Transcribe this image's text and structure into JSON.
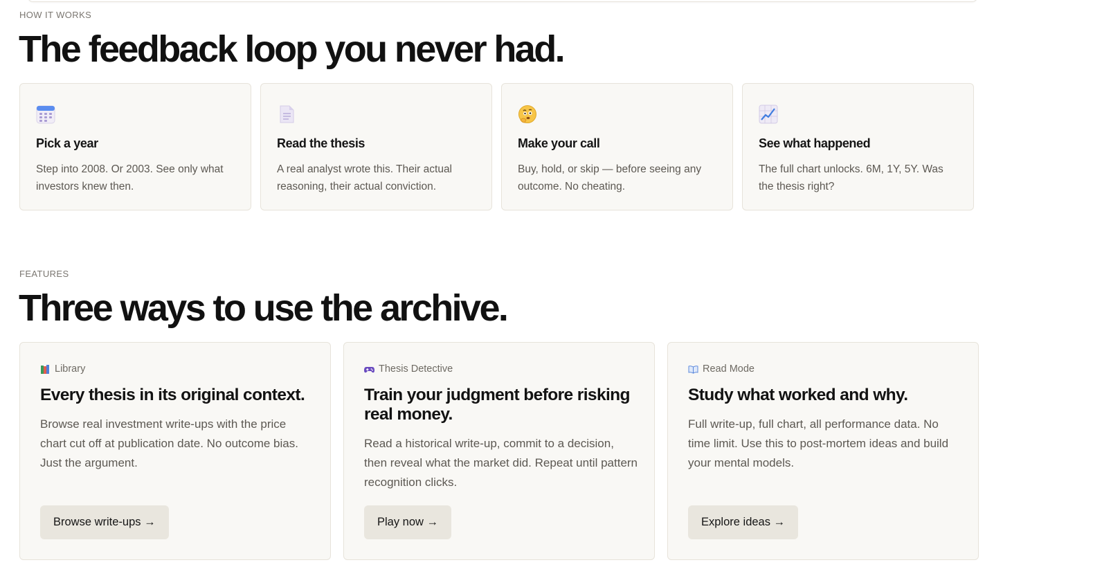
{
  "how_it_works": {
    "eyebrow": "HOW IT WORKS",
    "heading": "The feedback loop you never had.",
    "steps": [
      {
        "icon": "calendar-icon",
        "title": "Pick a year",
        "desc": "Step into 2008. Or 2003. See only what investors knew then."
      },
      {
        "icon": "document-icon",
        "title": "Read the thesis",
        "desc": "A real analyst wrote this. Their actual reasoning, their actual conviction."
      },
      {
        "icon": "thinking-face-icon",
        "title": "Make your call",
        "desc": "Buy, hold, or skip — before seeing any outcome. No cheating."
      },
      {
        "icon": "chart-increasing-icon",
        "title": "See what happened",
        "desc": "The full chart unlocks. 6M, 1Y, 5Y. Was the thesis right?"
      }
    ]
  },
  "features": {
    "eyebrow": "FEATURES",
    "heading": "Three ways to use the archive.",
    "cards": [
      {
        "icon": "books-icon",
        "tag": "Library",
        "title": "Every thesis in its original context.",
        "desc": "Browse real investment write-ups with the price chart cut off at publication date. No outcome bias. Just the argument.",
        "button": "Browse write-ups →"
      },
      {
        "icon": "game-controller-icon",
        "tag": "Thesis Detective",
        "title": "Train your judgment before risking real money.",
        "desc": "Read a historical write-up, commit to a decision, then reveal what the market did. Repeat until pattern recognition clicks.",
        "button": "Play now →"
      },
      {
        "icon": "open-book-icon",
        "tag": "Read Mode",
        "title": "Study what worked and why.",
        "desc": "Full write-up, full chart, all performance data. No time limit. Use this to post-mortem ideas and build your mental models.",
        "button": "Explore ideas →"
      }
    ]
  }
}
